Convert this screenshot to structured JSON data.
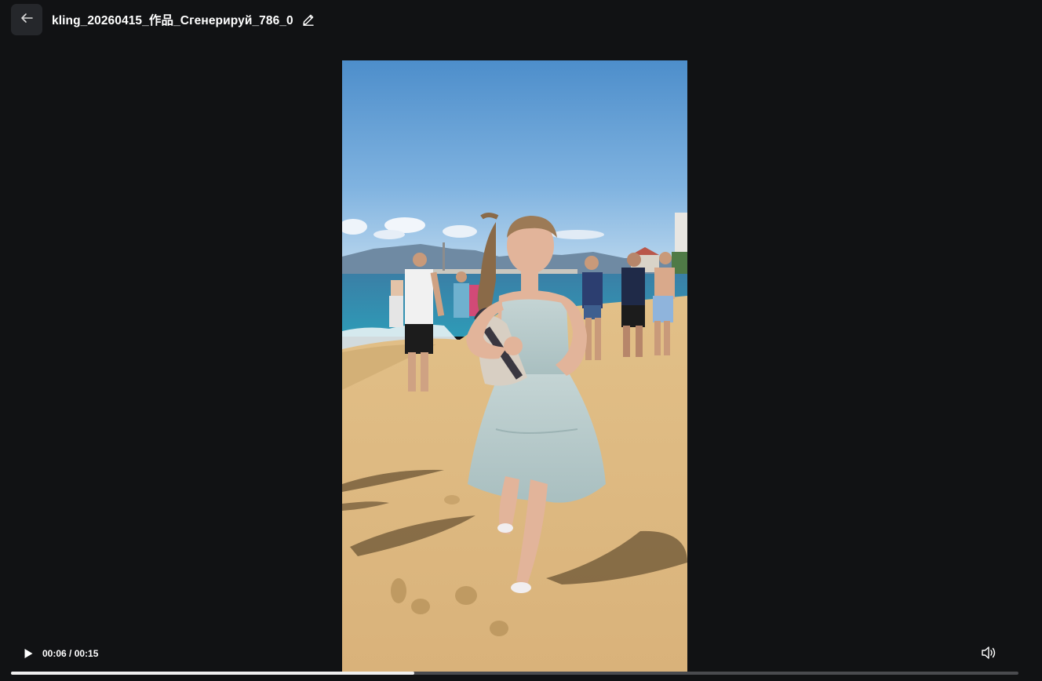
{
  "header": {
    "back_icon": "arrow-left-icon",
    "title": "kling_20260415_作品_Сгенерируй_786_0",
    "edit_icon": "pencil-icon"
  },
  "player": {
    "time_display": "00:06 / 00:15",
    "current_time": "00:06",
    "duration": "00:15",
    "progress_fraction": 0.4,
    "play_icon": "play-icon",
    "volume_icon": "volume-icon"
  },
  "colors": {
    "background": "#111214",
    "button_bg": "#25272b",
    "progress_fill": "#f0f0f0",
    "progress_track": "#4a4b4f"
  }
}
